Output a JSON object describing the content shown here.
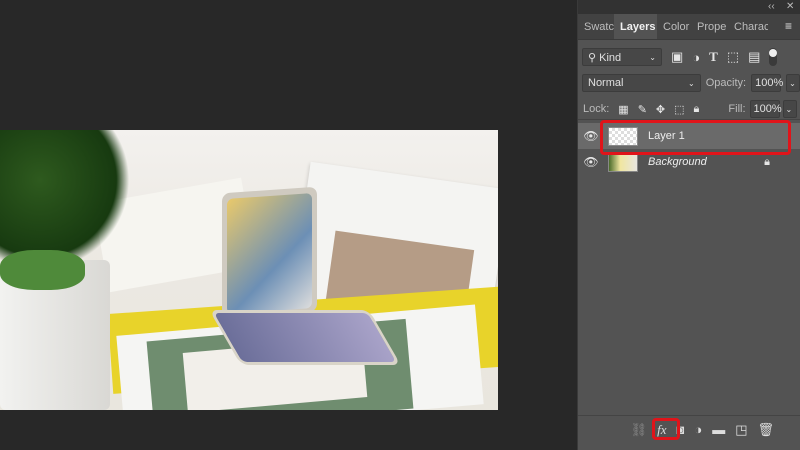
{
  "panel": {
    "tabs": [
      {
        "label": "Swatc"
      },
      {
        "label": "Layers"
      },
      {
        "label": "Color"
      },
      {
        "label": "Prope"
      },
      {
        "label": "Charac"
      }
    ],
    "filter": {
      "label": "Kind"
    },
    "blend_mode": "Normal",
    "opacity_label": "Opacity:",
    "opacity_value": "100%",
    "lock_label": "Lock:",
    "fill_label": "Fill:",
    "fill_value": "100%",
    "layers": [
      {
        "name": "Layer 1",
        "selected": true,
        "visible": true
      },
      {
        "name": "Background",
        "locked": true,
        "visible": true
      }
    ],
    "highlight_color": "#e0141a"
  }
}
